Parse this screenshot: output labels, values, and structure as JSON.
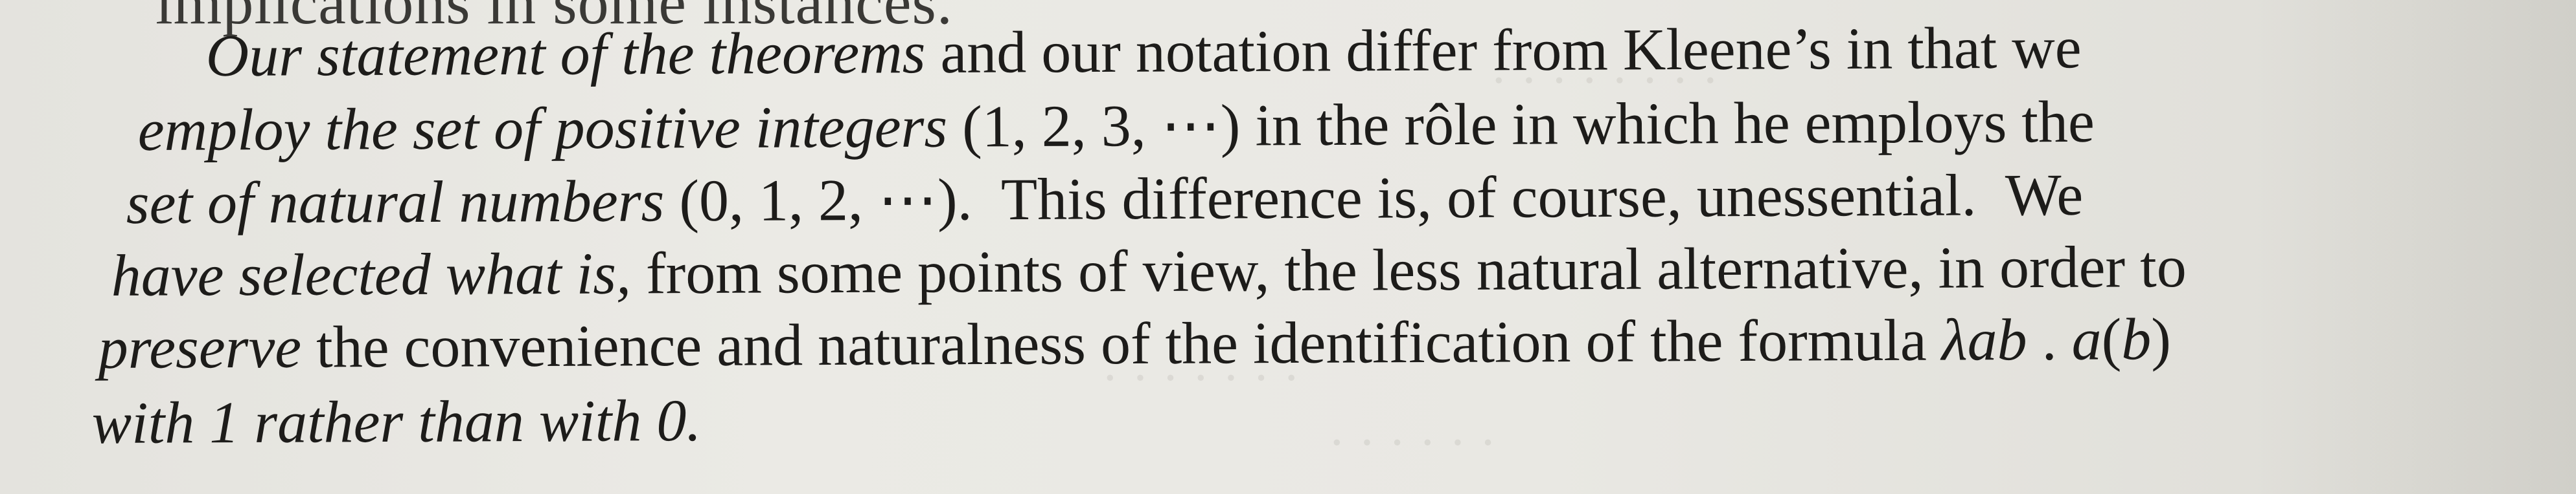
{
  "cut_line": "implications in some instances.",
  "lines": [
    [
      {
        "t": "Our statement of the theorems",
        "i": true
      },
      {
        "t": " and our notation differ from Kleene’s in that we",
        "i": false
      }
    ],
    [
      {
        "t": "employ the set of positive integers",
        "i": true
      },
      {
        "t": " (1, 2, 3, ⋯) in the rôle in which he employs the",
        "i": false
      }
    ],
    [
      {
        "t": "set of natural numbers",
        "i": true
      },
      {
        "t": " (0, 1, 2, ⋯).  This difference is, of course, unessential.  We",
        "i": false
      }
    ],
    [
      {
        "t": "have selected what is,",
        "i": true
      },
      {
        "t": " from some points of view, the less natural alternative, in order to",
        "i": false
      }
    ],
    [
      {
        "t": "preserve",
        "i": true
      },
      {
        "t": " the convenience and naturalness of the identification of the formula ",
        "i": false
      },
      {
        "t": "λab",
        "i": true
      },
      {
        "t": " . ",
        "i": false
      },
      {
        "t": "a",
        "i": true
      },
      {
        "t": "(",
        "i": false
      },
      {
        "t": "b",
        "i": true
      },
      {
        "t": ")",
        "i": false
      }
    ],
    [
      {
        "t": "with 1 rather than with 0.",
        "i": true
      }
    ]
  ]
}
